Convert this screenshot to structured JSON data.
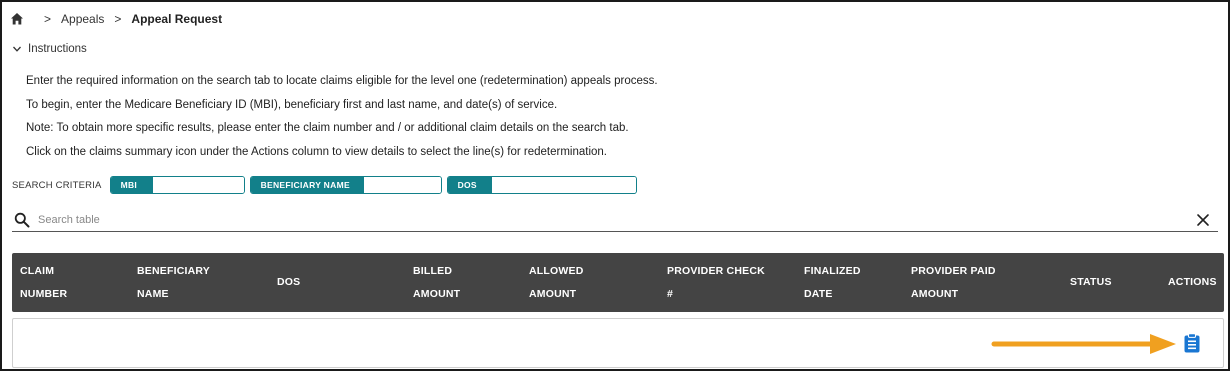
{
  "breadcrumb": {
    "home_icon": "home-icon",
    "items": [
      "Appeals",
      "Appeal Request"
    ]
  },
  "instructions": {
    "toggle_label": "Instructions",
    "lines": [
      "Enter the required information on the search tab to locate claims eligible for the level one (redetermination) appeals process.",
      "To begin, enter the Medicare Beneficiary ID (MBI), beneficiary first and last name, and date(s) of service.",
      "Note: To obtain more specific results, please enter the claim number and / or additional claim details on the search tab.",
      "Click on the claims summary icon under the Actions column to view details to select the line(s) for redetermination."
    ]
  },
  "search_criteria": {
    "label": "SEARCH CRITERIA",
    "fields": [
      {
        "tag": "MBI",
        "value": ""
      },
      {
        "tag": "BENEFICIARY NAME",
        "value": ""
      },
      {
        "tag": "DOS",
        "value": ""
      }
    ]
  },
  "search": {
    "placeholder": "Search table",
    "value": ""
  },
  "table": {
    "columns": [
      {
        "line1": "CLAIM",
        "line2": "NUMBER"
      },
      {
        "line1": "BENEFICIARY",
        "line2": "NAME"
      },
      {
        "line1": "DOS",
        "line2": ""
      },
      {
        "line1": "BILLED",
        "line2": "AMOUNT"
      },
      {
        "line1": "ALLOWED",
        "line2": "AMOUNT"
      },
      {
        "line1": "PROVIDER CHECK",
        "line2": "#"
      },
      {
        "line1": "FINALIZED",
        "line2": "DATE"
      },
      {
        "line1": "PROVIDER PAID",
        "line2": "AMOUNT"
      },
      {
        "line1": "STATUS",
        "line2": ""
      },
      {
        "line1": "ACTIONS",
        "line2": ""
      }
    ],
    "rows": [
      {
        "cells": [
          "",
          "",
          "",
          "",
          "",
          "",
          "",
          "",
          ""
        ],
        "action_icon": "clipboard-list-icon"
      }
    ]
  },
  "colors": {
    "accent": "#12808a",
    "header_bg": "#444444",
    "action_icon": "#1976d2",
    "annotation_arrow": "#f0a020"
  }
}
